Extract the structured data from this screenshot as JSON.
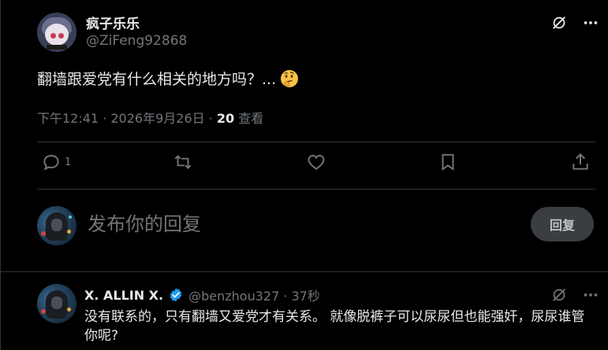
{
  "tweet": {
    "display_name": "疯子乐乐",
    "handle": "@ZiFeng92868",
    "text": "翻墙跟爱党有什么相关的地方吗？...",
    "emoji": "thinking-face",
    "timestamp": "下午12:41 · 2026年9月26日 · ",
    "views_count": "20",
    "views_label": " 查看",
    "reply_count": "1"
  },
  "composer": {
    "placeholder": "发布你的回复",
    "button_label": "回复"
  },
  "reply": {
    "display_name": "X. ALLIN X.",
    "handle": "@benzhou327 · 37秒",
    "text": "没有联系的，只有翻墙又爱党才有关系。 就像脱裤子可以尿尿但也能强奸，尿尿谁管你呢?"
  },
  "colors": {
    "background": "#000000",
    "text": "#e7e9ea",
    "muted": "#71767b",
    "divider": "#2f3336",
    "verified": "#1d9bf0",
    "reply_button_bg": "#3a3d41"
  }
}
